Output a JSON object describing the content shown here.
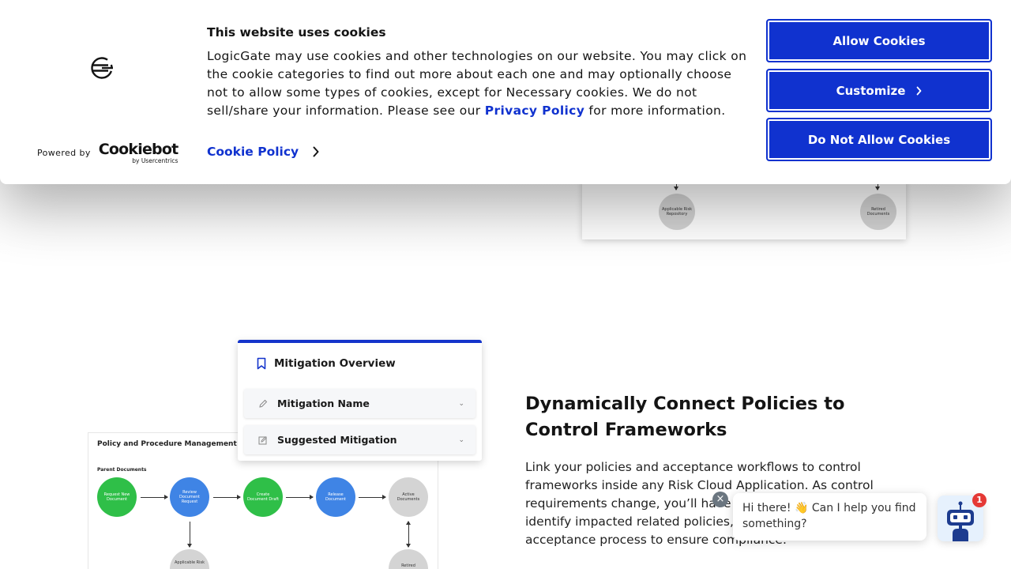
{
  "cookie_banner": {
    "title": "This website uses cookies",
    "body_text": "LogicGate may use cookies and other technologies on our website. You may click on the cookie categories to find out more about each one and may optionally choose not to allow some types of cookies, except for Necessary cookies.  We do not sell/share your information. Please see our ",
    "privacy_link": "Privacy Policy",
    "body_suffix": " for more information.",
    "cookie_policy_link": "Cookie Policy",
    "powered_by": "Powered by",
    "brand_name": "Cookiebot",
    "brand_sub": "by Usercentrics",
    "buttons": {
      "allow": "Allow Cookies",
      "customize": "Customize",
      "deny": "Do Not Allow Cookies"
    },
    "accent_color": "#1032cf"
  },
  "top_diagram": {
    "nodes": [
      "Applicable Risk Repository",
      "Retired Documents"
    ]
  },
  "mitigation_card": {
    "title": "Mitigation Overview",
    "rows": [
      "Mitigation Name",
      "Suggested Mitigation"
    ]
  },
  "ppm_diagram": {
    "title": "Policy and Procedure Management",
    "section": "Parent Documents",
    "nodes": [
      "Request New Document",
      "Review Document Request",
      "Create Document Draft",
      "Release Document",
      "Active Documents"
    ],
    "bottom_nodes": [
      "Applicable Risk",
      "Retired"
    ]
  },
  "feature": {
    "title": "Dynamically Connect Policies to Control Frameworks",
    "body": "Link your policies and acceptance workflows to control frameworks inside any Risk Cloud Application. As control requirements change, you’ll have the visibility you need to identify impacted related policies, and automate the end-to-end acceptance process to ensure compliance."
  },
  "chat": {
    "message": "Hi there! 👋 Can I help you find something?",
    "badge_count": "1",
    "close_glyph": "×"
  }
}
